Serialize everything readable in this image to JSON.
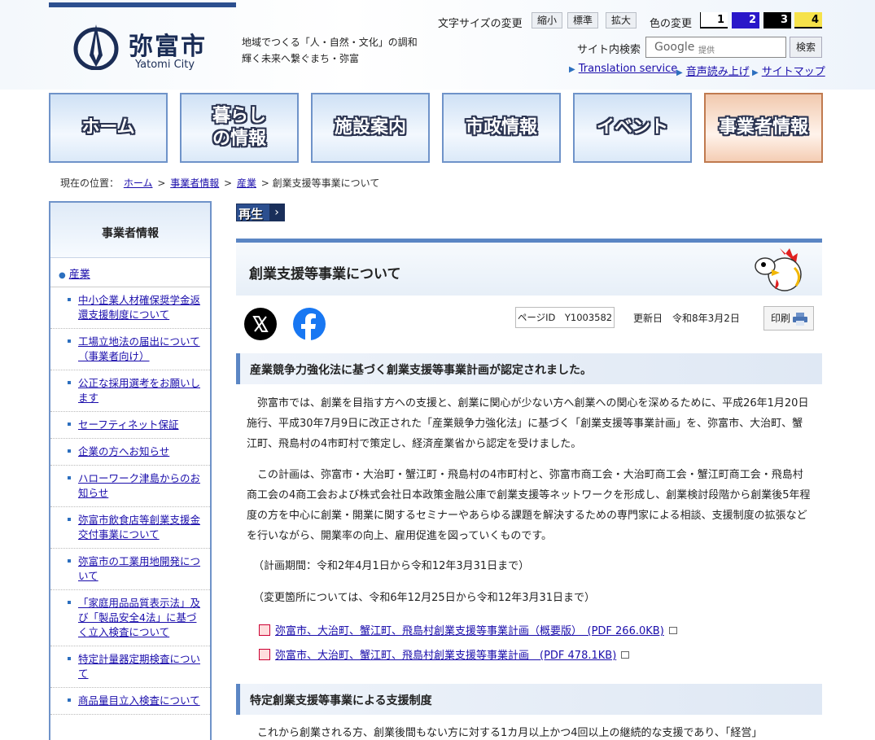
{
  "header": {
    "city_name": "弥富市",
    "city_name_en": "Yatomi City",
    "slogan_line1": "地域でつくる「人・自然・文化」の調和",
    "slogan_line2": "輝く未来へ繋ぐまち・弥富",
    "font_size_label": "文字サイズの変更",
    "font_size_buttons": [
      "縮小",
      "標準",
      "拡大"
    ],
    "color_label": "色の変更",
    "color_buttons": [
      {
        "label": "1",
        "bg": "#ffffff",
        "fg": "#000000"
      },
      {
        "label": "2",
        "bg": "#2a17c9",
        "fg": "#ffffff"
      },
      {
        "label": "3",
        "bg": "#000000",
        "fg": "#ffffff"
      },
      {
        "label": "4",
        "bg": "#f6e24a",
        "fg": "#000000"
      }
    ],
    "search_label": "サイト内検索",
    "search_placeholder_brand": "Google",
    "search_placeholder_sub": "提供",
    "search_button": "検索",
    "links": [
      "Translation service",
      "音声読み上げ",
      "サイトマップ"
    ]
  },
  "gnav": [
    "ホーム",
    "暮らし\nの情報",
    "施設案内",
    "市政情報",
    "イベント",
    "事業者情報"
  ],
  "breadcrumb": {
    "prefix": "現在の位置：",
    "items": [
      "ホーム",
      "事業者情報",
      "産業"
    ],
    "current": "創業支援等事業について",
    "separator": ">"
  },
  "sidebar": {
    "title": "事業者情報",
    "category": "産業",
    "items": [
      "中小企業人材確保奨学金返還支援制度について",
      "工場立地法の届出について（事業者向け）",
      "公正な採用選考をお願いします",
      "セーフティネット保証",
      "企業の方へお知らせ",
      "ハローワーク津島からのお知らせ",
      "弥富市飲食店等創業支援金交付事業について",
      "弥富市の工業用地開発について",
      "「家庭用品品質表示法」及び「製品安全4法」に基づく立入検査について",
      "特定計量器定期検査について",
      "商品量目立入検査について"
    ]
  },
  "main": {
    "play_label": "再生",
    "title": "創業支援等事業について",
    "page_id_label": "ページID　Y1003582",
    "updated_label": "更新日　令和8年3月2日",
    "print_label": "印刷",
    "section1_heading": "産業競争力強化法に基づく創業支援等事業計画が認定されました。",
    "para1": "弥富市では、創業を目指す方への支援と、創業に関心が少ない方へ創業への関心を深めるために、平成26年1月20日施行、平成30年7月9日に改正された「産業競争力強化法」に基づく「創業支援等事業計画」を、弥富市、大治町、蟹江町、飛島村の4市町村で策定し、経済産業省から認定を受けました。",
    "para2": "この計画は、弥富市・大治町・蟹江町・飛島村の4市町村と、弥富市商工会・大治町商工会・蟹江町商工会・飛島村商工会の4商工会および株式会社日本政策金融公庫で創業支援等ネットワークを形成し、創業検討段階から創業後5年程度の方を中心に創業・開業に関するセミナーやあらゆる課題を解決するための専門家による相談、支援制度の拡張などを行いながら、開業率の向上、雇用促進を図っていくものです。",
    "para3": "（計画期間：令和2年4月1日から令和12年3月31日まで）",
    "para4": "（変更箇所については、令和6年12月25日から令和12年3月31日まで）",
    "doc1": "弥富市、大治町、蟹江町、飛島村創業支援等事業計画（概要版）　(PDF 266.0KB)",
    "doc2": "弥富市、大治町、蟹江町、飛島村創業支援等事業計画　(PDF 478.1KB)",
    "section2_heading": "特定創業支援等事業による支援制度",
    "para5": "これから創業される方、創業後間もない方に対する1カ月以上かつ4回以上の継続的な支援であり、「経営」"
  }
}
